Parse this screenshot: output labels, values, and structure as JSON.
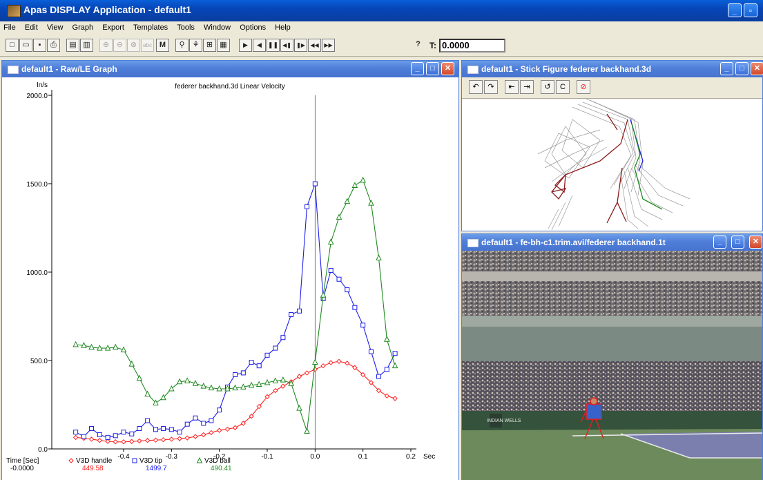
{
  "app": {
    "title": "Apas DISPLAY Application - default1"
  },
  "menu": [
    "File",
    "Edit",
    "View",
    "Graph",
    "Export",
    "Templates",
    "Tools",
    "Window",
    "Options",
    "Help"
  ],
  "toolbar": {
    "time_label": "T:",
    "time_value": "0.0000"
  },
  "graph_window": {
    "title": "default1 - Raw/LE Graph",
    "chart_data": {
      "type": "line",
      "title": "federer backhand.3d Linear Velocity",
      "ylabel": "In/s",
      "xlabel": "Sec",
      "xlim": [
        -0.55,
        0.2
      ],
      "ylim": [
        0,
        2000
      ],
      "x_ticks": [
        -0.4,
        -0.3,
        -0.2,
        -0.1,
        0.0,
        0.1,
        0.2
      ],
      "x_tick_labels": [
        "-0.4",
        "-0.3",
        "-0.2",
        "-0.1",
        "0.0",
        "0.1",
        "0.2"
      ],
      "y_ticks": [
        0,
        500,
        1000,
        1500,
        2000
      ],
      "y_tick_labels": [
        "0.0",
        "500.0",
        "1000.0",
        "1500.0",
        "2000.0"
      ],
      "cursor_x": 0.0,
      "series": [
        {
          "name": "V3D handle",
          "marker": "diamond",
          "color": "#ff2020",
          "readout": "449.58",
          "x": [
            -0.5,
            -0.483,
            -0.467,
            -0.45,
            -0.433,
            -0.417,
            -0.4,
            -0.383,
            -0.367,
            -0.35,
            -0.333,
            -0.317,
            -0.3,
            -0.283,
            -0.267,
            -0.25,
            -0.233,
            -0.217,
            -0.2,
            -0.183,
            -0.167,
            -0.15,
            -0.133,
            -0.117,
            -0.1,
            -0.083,
            -0.067,
            -0.05,
            -0.033,
            -0.017,
            0.0,
            0.017,
            0.033,
            0.05,
            0.067,
            0.083,
            0.1,
            0.117,
            0.133,
            0.15,
            0.167
          ],
          "y": [
            65,
            60,
            55,
            48,
            43,
            40,
            40,
            42,
            45,
            48,
            50,
            52,
            55,
            58,
            62,
            70,
            80,
            92,
            105,
            112,
            120,
            145,
            185,
            240,
            295,
            330,
            355,
            380,
            410,
            430,
            449.58,
            470,
            488,
            495,
            485,
            460,
            420,
            375,
            330,
            300,
            285
          ]
        },
        {
          "name": "V3D tip",
          "marker": "square",
          "color": "#1c1ce8",
          "readout": "1499.7",
          "x": [
            -0.5,
            -0.483,
            -0.467,
            -0.45,
            -0.433,
            -0.417,
            -0.4,
            -0.383,
            -0.367,
            -0.35,
            -0.333,
            -0.317,
            -0.3,
            -0.283,
            -0.267,
            -0.25,
            -0.233,
            -0.217,
            -0.2,
            -0.183,
            -0.167,
            -0.15,
            -0.133,
            -0.117,
            -0.1,
            -0.083,
            -0.067,
            -0.05,
            -0.033,
            -0.017,
            0.0,
            0.017,
            0.033,
            0.05,
            0.067,
            0.083,
            0.1,
            0.117,
            0.133,
            0.15,
            0.167
          ],
          "y": [
            95,
            70,
            115,
            80,
            65,
            75,
            95,
            85,
            115,
            160,
            110,
            115,
            110,
            95,
            140,
            175,
            145,
            160,
            220,
            350,
            420,
            430,
            490,
            470,
            530,
            570,
            630,
            760,
            780,
            1370,
            1499.7,
            850,
            1010,
            960,
            900,
            800,
            700,
            550,
            410,
            450,
            540
          ]
        },
        {
          "name": "V3D ball",
          "marker": "triangle",
          "color": "#1f8a1f",
          "readout": "490.41",
          "x": [
            -0.5,
            -0.483,
            -0.467,
            -0.45,
            -0.433,
            -0.417,
            -0.4,
            -0.383,
            -0.367,
            -0.35,
            -0.333,
            -0.317,
            -0.3,
            -0.283,
            -0.267,
            -0.25,
            -0.233,
            -0.217,
            -0.2,
            -0.183,
            -0.167,
            -0.15,
            -0.133,
            -0.117,
            -0.1,
            -0.083,
            -0.067,
            -0.05,
            -0.033,
            -0.017,
            0.0,
            0.017,
            0.033,
            0.05,
            0.067,
            0.083,
            0.1,
            0.117,
            0.133,
            0.15,
            0.167
          ],
          "y": [
            590,
            585,
            575,
            570,
            570,
            575,
            560,
            480,
            400,
            310,
            260,
            290,
            340,
            380,
            385,
            370,
            355,
            345,
            340,
            340,
            345,
            350,
            360,
            365,
            375,
            385,
            390,
            370,
            230,
            100,
            490.41,
            870,
            1170,
            1310,
            1400,
            1490,
            1520,
            1390,
            1080,
            620,
            470
          ]
        }
      ],
      "legend": {
        "time_label": "Time [Sec]",
        "time_value": "-0.0000"
      }
    }
  },
  "stick_window": {
    "title": "default1 - Stick Figure  federer backhand.3d"
  },
  "video_window": {
    "title": "default1 - fe-bh-c1.trim.avi/federer backhand.1t",
    "banner_text": "INDIAN WELLS"
  },
  "colors": {
    "title_bar": "#0a5fd8",
    "child_title": "#5581d8",
    "handle": "#ff2020",
    "tip": "#1c1ce8",
    "ball": "#1f8a1f"
  }
}
